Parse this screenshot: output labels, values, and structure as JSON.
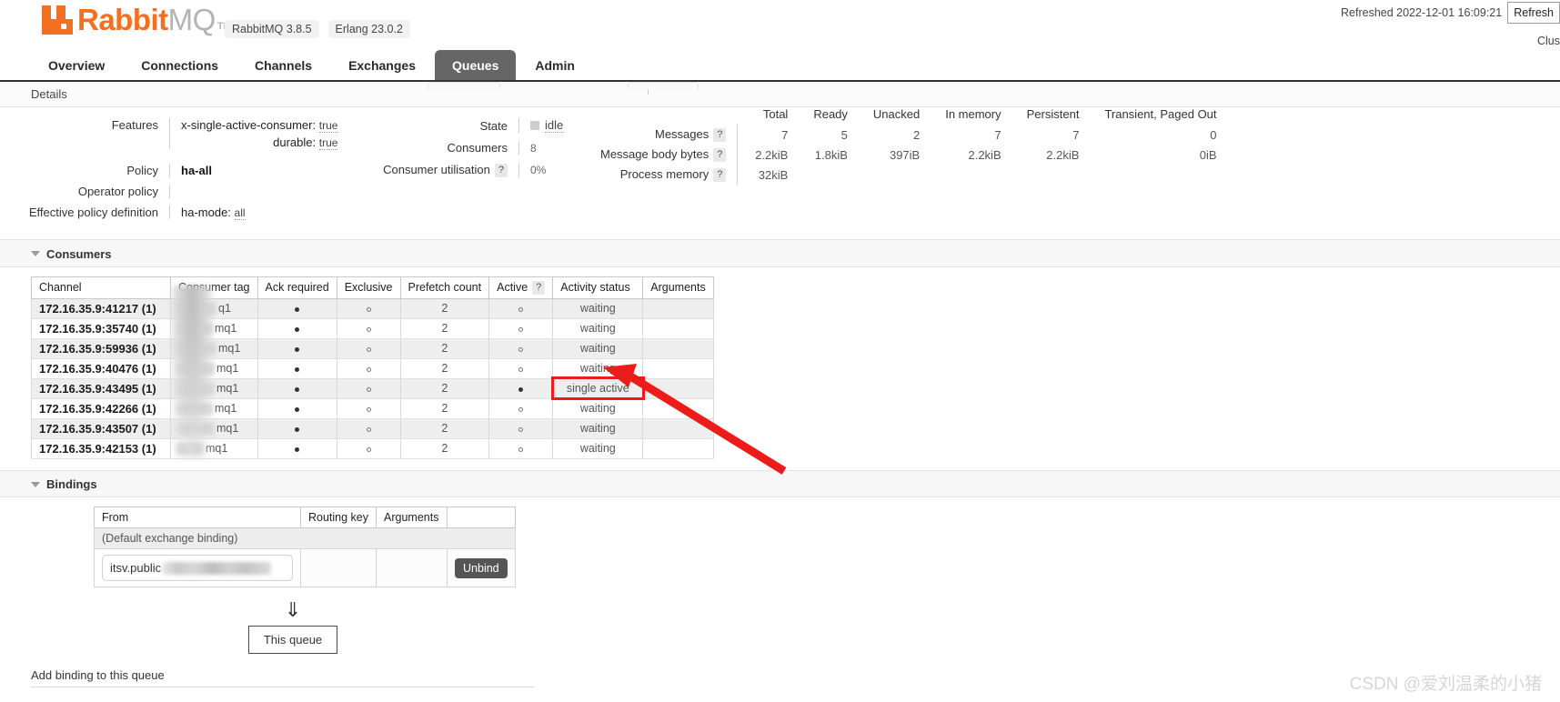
{
  "brand": {
    "name_first": "Rabbit",
    "name_second": "MQ",
    "tm": "TM",
    "rabbitmq_version": "RabbitMQ 3.8.5",
    "erlang_version": "Erlang 23.0.2"
  },
  "header": {
    "refreshed_text": "Refreshed 2022-12-01 16:09:21",
    "refresh_button": "Refresh",
    "cluster_label": "Clus"
  },
  "nav": {
    "items": [
      {
        "label": "Overview",
        "active": false
      },
      {
        "label": "Connections",
        "active": false
      },
      {
        "label": "Channels",
        "active": false
      },
      {
        "label": "Exchanges",
        "active": false
      },
      {
        "label": "Queues",
        "active": true
      },
      {
        "label": "Admin",
        "active": false
      }
    ]
  },
  "details": {
    "section_title": "Details",
    "features_label": "Features",
    "features": [
      {
        "key": "x-single-active-consumer:",
        "value": "true"
      },
      {
        "key": "durable:",
        "value": "true"
      }
    ],
    "policy_label": "Policy",
    "policy_value": "ha-all",
    "operator_policy_label": "Operator policy",
    "operator_policy_value": "",
    "effective_policy_label": "Effective policy definition",
    "effective_policy_key": "ha-mode:",
    "effective_policy_value": "all",
    "state_label": "State",
    "state_value": "idle",
    "consumers_label": "Consumers",
    "consumers_value": "8",
    "consumer_utilisation_label": "Consumer utilisation",
    "consumer_utilisation_value": "0%",
    "help_mark": "?"
  },
  "stats": {
    "columns": [
      "Total",
      "Ready",
      "Unacked",
      "In memory",
      "Persistent",
      "Transient, Paged Out"
    ],
    "rows": [
      {
        "label": "Messages",
        "help": "?",
        "values": [
          "7",
          "5",
          "2",
          "7",
          "7",
          "0"
        ]
      },
      {
        "label": "Message body bytes",
        "help": "?",
        "values": [
          "2.2kiB",
          "1.8kiB",
          "397iB",
          "2.2kiB",
          "2.2kiB",
          "0iB"
        ]
      },
      {
        "label": "Process memory",
        "help": "?",
        "values": [
          "32kiB",
          "",
          "",
          "",
          "",
          ""
        ]
      }
    ]
  },
  "consumers_section": {
    "title": "Consumers",
    "columns": [
      "Channel",
      "Consumer tag",
      "Ack required",
      "Exclusive",
      "Prefetch count",
      "Active",
      "Activity status",
      "Arguments"
    ],
    "active_help": "?",
    "rows": [
      {
        "channel": "172.16.35.9:41217 (1)",
        "tag_suffix": "q1",
        "ack": "filled",
        "exclusive": "open",
        "prefetch": "2",
        "active": "open",
        "status": "waiting",
        "arguments": "",
        "highlight": false
      },
      {
        "channel": "172.16.35.9:35740 (1)",
        "tag_suffix": "mq1",
        "ack": "filled",
        "exclusive": "open",
        "prefetch": "2",
        "active": "open",
        "status": "waiting",
        "arguments": "",
        "highlight": false
      },
      {
        "channel": "172.16.35.9:59936 (1)",
        "tag_suffix": "mq1",
        "ack": "filled",
        "exclusive": "open",
        "prefetch": "2",
        "active": "open",
        "status": "waiting",
        "arguments": "",
        "highlight": false
      },
      {
        "channel": "172.16.35.9:40476 (1)",
        "tag_suffix": "mq1",
        "ack": "filled",
        "exclusive": "open",
        "prefetch": "2",
        "active": "open",
        "status": "waiting",
        "arguments": "",
        "highlight": false
      },
      {
        "channel": "172.16.35.9:43495 (1)",
        "tag_suffix": "mq1",
        "ack": "filled",
        "exclusive": "open",
        "prefetch": "2",
        "active": "filled",
        "status": "single active",
        "arguments": "",
        "highlight": true
      },
      {
        "channel": "172.16.35.9:42266 (1)",
        "tag_suffix": "mq1",
        "ack": "filled",
        "exclusive": "open",
        "prefetch": "2",
        "active": "open",
        "status": "waiting",
        "arguments": "",
        "highlight": false
      },
      {
        "channel": "172.16.35.9:43507 (1)",
        "tag_suffix": "mq1",
        "ack": "filled",
        "exclusive": "open",
        "prefetch": "2",
        "active": "open",
        "status": "waiting",
        "arguments": "",
        "highlight": false
      },
      {
        "channel": "172.16.35.9:42153 (1)",
        "tag_suffix": "mq1",
        "ack": "filled",
        "exclusive": "open",
        "prefetch": "2",
        "active": "open",
        "status": "waiting",
        "arguments": "",
        "highlight": false
      }
    ]
  },
  "bindings_section": {
    "title": "Bindings",
    "columns": [
      "From",
      "Routing key",
      "Arguments",
      ""
    ],
    "default_row": "(Default exchange binding)",
    "from_value": "itsv.public",
    "routing_key": "",
    "arguments": "",
    "unbind_button": "Unbind",
    "down_arrow": "⇓",
    "this_queue": "This queue",
    "add_binding_label": "Add binding to this queue"
  },
  "annotation": {
    "highlight_color": "#ee1b1b",
    "arrow_color": "#ee1b1b"
  },
  "watermark": {
    "text": "CSDN @爱刘温柔的小猪"
  }
}
